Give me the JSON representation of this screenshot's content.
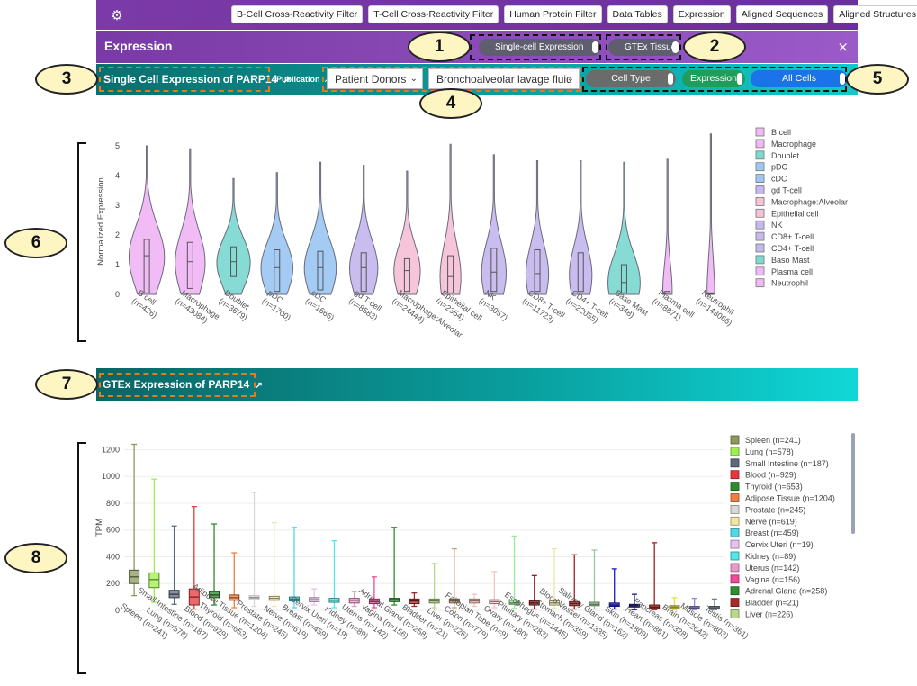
{
  "nav": {
    "settings_icon": "gear-icon",
    "buttons": [
      "B-Cell Cross-Reactivity Filter",
      "T-Cell Cross-Reactivity Filter",
      "Human Protein Filter",
      "Data Tables",
      "Expression",
      "Aligned Sequences",
      "Aligned Structures"
    ]
  },
  "expression": {
    "title": "Expression",
    "single_cell_switch": "Single-cell Expression",
    "gtex_switch": "GTEx Tissue",
    "close_icon": "×"
  },
  "single_cell": {
    "title": "Single Cell Expression of PARP14",
    "external_link_icon": "external-link-icon",
    "publication_label": "Publication",
    "donor_select": "Patient Donors",
    "tissue_select": "Bronchoalveolar lavage fluid",
    "toggles": [
      "Cell Type",
      "Expression",
      "All Cells"
    ],
    "toggle_colors": [
      "#6b6b6b",
      "#1e9e5a",
      "#1a73e8"
    ]
  },
  "gtex": {
    "title": "GTEx Expression of PARP14"
  },
  "callouts": [
    "1",
    "2",
    "3",
    "4",
    "5",
    "6",
    "7",
    "8"
  ],
  "chart_data": [
    {
      "type": "violin",
      "title": "",
      "ylabel": "Normalized Expression",
      "ylim": [
        0,
        5
      ],
      "yticks": [
        "0",
        "1",
        "2",
        "3",
        "4",
        "5"
      ],
      "categories": [
        "B cell",
        "Macrophage",
        "Doublet",
        "pDC",
        "cDC",
        "gd T-cell",
        "Macrophage:Alveolar",
        "Epithelial cell",
        "NK",
        "CD8+ T-cell",
        "CD4+ T-cell",
        "Baso Mast",
        "Plasma cell",
        "Neutrophil"
      ],
      "tick_labels": [
        [
          "B cell",
          "(n=426)"
        ],
        [
          "Macrophage",
          "(n=43084)"
        ],
        [
          "Doublet",
          "(n=3679)"
        ],
        [
          "pDC",
          "(n=1700)"
        ],
        [
          "cDC",
          "(n=1666)"
        ],
        [
          "gd T-cell",
          "(n=8583)"
        ],
        [
          "Macrophage:Alveolar",
          "(n=24444)"
        ],
        [
          "Epithelial cell",
          "(n=2354)"
        ],
        [
          "NK",
          "(n=3057)"
        ],
        [
          "CD8+ T-cell",
          "(n=11723)"
        ],
        [
          "CD4+ T-cell",
          "(n=22055)"
        ],
        [
          "Baso Mast",
          "(n=348)"
        ],
        [
          "Plasma cell",
          "(n=8871)"
        ],
        [
          "Neutrophil",
          "(n=143066)"
        ]
      ],
      "colors": [
        "#f0b8f5",
        "#f0b8f5",
        "#7fd9d2",
        "#9ec8f2",
        "#9ec8f2",
        "#c6b9ef",
        "#f5c2d8",
        "#f5c2d8",
        "#c6b9ef",
        "#c6b9ef",
        "#c6b9ef",
        "#7fd9d2",
        "#f0b8f5",
        "#f0b8f5"
      ],
      "max": [
        5.0,
        4.9,
        3.9,
        4.1,
        4.45,
        4.35,
        4.15,
        5.05,
        4.7,
        4.5,
        4.5,
        4.45,
        4.55,
        5.4
      ],
      "q1": [
        0.05,
        0.2,
        0.6,
        0.1,
        0.15,
        0.1,
        0.1,
        0.05,
        0.1,
        0.1,
        0.1,
        0.05,
        0.0,
        0.0
      ],
      "median": [
        1.3,
        1.1,
        1.1,
        0.9,
        0.9,
        0.9,
        0.8,
        0.6,
        0.75,
        0.7,
        0.65,
        0.4,
        0.05,
        0.03
      ],
      "q3": [
        1.85,
        1.75,
        1.6,
        1.5,
        1.45,
        1.4,
        1.2,
        1.3,
        1.55,
        1.5,
        1.4,
        1.0,
        0.1,
        0.05
      ],
      "max_width": [
        0.95,
        0.8,
        0.9,
        0.85,
        0.85,
        0.75,
        0.7,
        0.55,
        0.65,
        0.6,
        0.6,
        0.85,
        0.25,
        0.2
      ],
      "legend": [
        "B cell",
        "Macrophage",
        "Doublet",
        "pDC",
        "cDC",
        "gd T-cell",
        "Macrophage:Alveolar",
        "Epithelial cell",
        "NK",
        "CD8+ T-cell",
        "CD4+ T-cell",
        "Baso Mast",
        "Plasma cell",
        "Neutrophil"
      ],
      "legend_position": "right"
    },
    {
      "type": "box",
      "title": "",
      "ylabel": "TPM",
      "ylim": [
        0,
        1250
      ],
      "yticks": [
        "0",
        "200",
        "400",
        "600",
        "800",
        "1000",
        "1200"
      ],
      "categories": [
        "Spleen (n=241)",
        "Lung (n=578)",
        "Small Intestine (n=187)",
        "Blood (n=929)",
        "Thyroid (n=653)",
        "Adipose Tissue (n=1204)",
        "Prostate (n=245)",
        "Nerve (n=619)",
        "Breast (n=459)",
        "Cervix Uteri (n=19)",
        "Kidney (n=89)",
        "Uterus (n=142)",
        "Vagina (n=156)",
        "Adrenal Gland (n=258)",
        "Bladder (n=21)",
        "Liver (n=226)",
        "Colon (n=779)",
        "Fallopian Tube (n=9)",
        "Ovary (n=180)",
        "Pituitary (n=283)",
        "Esophagus (n=1445)",
        "Stomach (n=359)",
        "Blood Vessel (n=1335)",
        "Salivary Gland (n=162)",
        "Skin (n=1809)",
        "Heart (n=861)",
        "Pancreas (n=328)",
        "Brain (n=2642)",
        "Muscle (n=803)",
        "Testis (n=361)"
      ],
      "colors": [
        "#8a9a5b",
        "#9ef04a",
        "#5b6b7a",
        "#e8363a",
        "#2e8b2e",
        "#f47c3c",
        "#d8d8d8",
        "#f2e6a0",
        "#4fd8e8",
        "#e8c2ee",
        "#52e8e8",
        "#ee96c8",
        "#f04a9a",
        "#2f8f2f",
        "#a52a2a",
        "#b8d88a",
        "#c8a070",
        "#f5c2b8",
        "#f5c4c8",
        "#98ec98",
        "#8b1a1a",
        "#ede5a8",
        "#a51e1e",
        "#9cc89c",
        "#1a1acc",
        "#1a1a7a",
        "#a52020",
        "#e8e040",
        "#9a88e0",
        "#708090"
      ],
      "max": [
        1240,
        980,
        630,
        775,
        645,
        430,
        880,
        655,
        620,
        160,
        520,
        140,
        250,
        620,
        130,
        350,
        460,
        120,
        290,
        555,
        260,
        460,
        415,
        450,
        310,
        120,
        505,
        95,
        90,
        85
      ],
      "q3": [
        300,
        280,
        150,
        160,
        140,
        115,
        110,
        105,
        100,
        95,
        90,
        90,
        85,
        90,
        85,
        85,
        85,
        85,
        80,
        75,
        70,
        70,
        65,
        60,
        55,
        45,
        40,
        35,
        30,
        30
      ],
      "median": [
        250,
        230,
        120,
        100,
        115,
        95,
        95,
        90,
        85,
        80,
        75,
        75,
        65,
        80,
        70,
        70,
        70,
        70,
        65,
        55,
        55,
        55,
        50,
        45,
        40,
        35,
        25,
        25,
        20,
        20
      ],
      "q1": [
        200,
        170,
        95,
        40,
        95,
        75,
        80,
        75,
        70,
        65,
        60,
        55,
        50,
        65,
        50,
        55,
        55,
        55,
        50,
        45,
        40,
        40,
        35,
        35,
        30,
        25,
        15,
        15,
        15,
        12
      ],
      "min": [
        110,
        60,
        45,
        10,
        40,
        20,
        30,
        30,
        20,
        40,
        20,
        30,
        20,
        40,
        30,
        20,
        20,
        30,
        20,
        15,
        10,
        15,
        10,
        10,
        10,
        5,
        5,
        5,
        5,
        5
      ],
      "legend": [
        "Spleen (n=241)",
        "Lung (n=578)",
        "Small Intestine (n=187)",
        "Blood (n=929)",
        "Thyroid (n=653)",
        "Adipose Tissue (n=1204)",
        "Prostate (n=245)",
        "Nerve (n=619)",
        "Breast (n=459)",
        "Cervix Uteri (n=19)",
        "Kidney (n=89)",
        "Uterus (n=142)",
        "Vagina (n=156)",
        "Adrenal Gland (n=258)",
        "Bladder (n=21)",
        "Liver (n=226)"
      ],
      "legend_position": "right"
    }
  ]
}
